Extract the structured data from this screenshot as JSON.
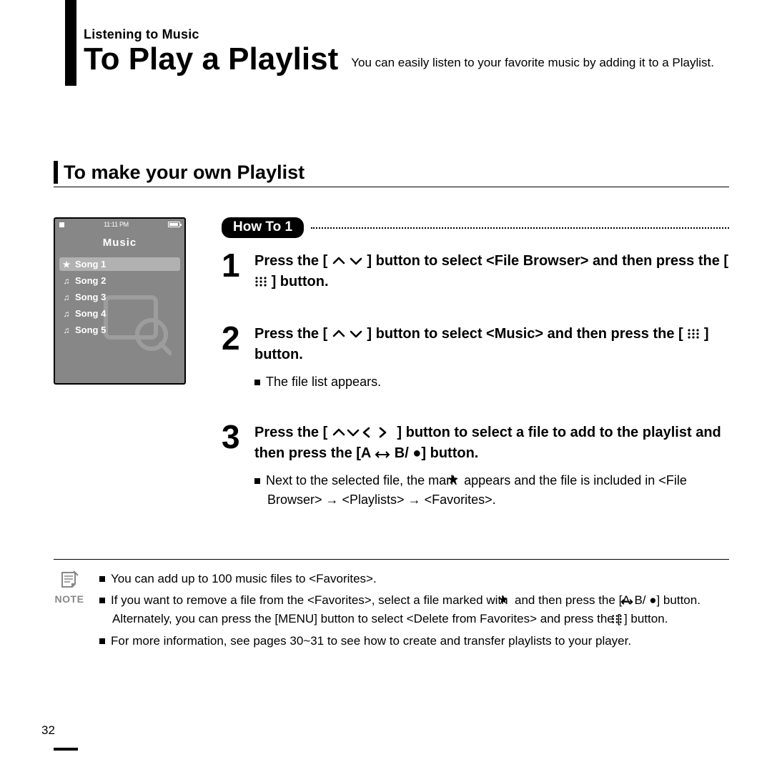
{
  "header": {
    "overline": "Listening to Music",
    "title": "To Play a Playlist",
    "subtitle": "You can easily listen to your favorite music by adding it to a Playlist."
  },
  "section": {
    "heading": "To make your own Playlist"
  },
  "device": {
    "time_left": "11:11 PM",
    "heading": "Music",
    "items": [
      {
        "label": "Song 1",
        "icon": "star",
        "selected": true
      },
      {
        "label": "Song 2",
        "icon": "note",
        "selected": false
      },
      {
        "label": "Song 3",
        "icon": "note",
        "selected": false
      },
      {
        "label": "Song 4",
        "icon": "note",
        "selected": false
      },
      {
        "label": "Song 5",
        "icon": "note",
        "selected": false
      }
    ]
  },
  "howto_badge": "How To 1",
  "steps": {
    "s1": {
      "num": "1",
      "pre": "Press the [",
      "post": "] button to select <File Browser> and then press the [",
      "end": "] button."
    },
    "s2": {
      "num": "2",
      "pre": "Press the [",
      "post": "] button to select <Music> and then press the [",
      "end": "] button.",
      "sub": "The file list appears."
    },
    "s3": {
      "num": "3",
      "pre": "Press the [",
      "post": "] button to select a file to add to the playlist and then press the [A",
      "end": "B/ ●] button.",
      "sub_pre": "Next to the selected file, the mark ",
      "sub_post": " appears and the file is included in <File Browser> → <Playlists> → <Favorites>."
    }
  },
  "note": {
    "label": "NOTE",
    "n1": "You can add up to 100 music files to <Favorites>.",
    "n2_pre": "If you want to remove a file from the <Favorites>, select a file marked with ",
    "n2_mid": " and then press the [A",
    "n2_post": "B/ ●] button. Alternately, you can press the [MENU] button to select <Delete from Favorites> and press the [",
    "n2_end": "] button.",
    "n3": "For more information, see pages 30~31 to see how to create and transfer playlists to your player."
  },
  "page_number": "32"
}
